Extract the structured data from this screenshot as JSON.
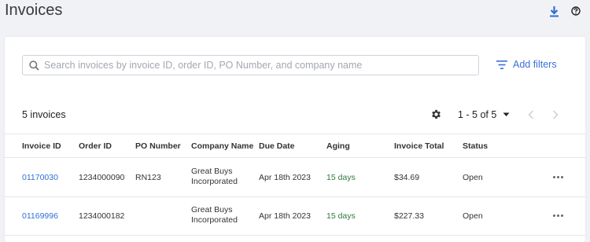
{
  "header": {
    "title": "Invoices",
    "download_icon": "download-icon",
    "help_icon": "help-icon"
  },
  "search": {
    "placeholder": "Search invoices by invoice ID, order ID, PO Number, and company name",
    "value": ""
  },
  "filters": {
    "label": "Add filters"
  },
  "summary": {
    "count": "5 invoices"
  },
  "pagination": {
    "range": "1 - 5 of 5"
  },
  "table": {
    "columns": [
      "Invoice ID",
      "Order ID",
      "PO Number",
      "Company Name",
      "Due Date",
      "Aging",
      "Invoice Total",
      "Status"
    ],
    "rows": [
      {
        "invoice_id": "01170030",
        "order_id": "1234000090",
        "po_number": "RN123",
        "company": "Great Buys Incorporated",
        "due_date": "Apr 18th 2023",
        "aging": "15 days",
        "total": "$34.69",
        "status": "Open"
      },
      {
        "invoice_id": "01169996",
        "order_id": "1234000182",
        "po_number": "",
        "company": "Great Buys Incorporated",
        "due_date": "Apr 18th 2023",
        "aging": "15 days",
        "total": "$227.33",
        "status": "Open"
      }
    ]
  },
  "colors": {
    "accent": "#3a6fd8",
    "link": "#2f6fd6",
    "aging_green": "#2f7a3a",
    "background": "#f1f2f6"
  }
}
